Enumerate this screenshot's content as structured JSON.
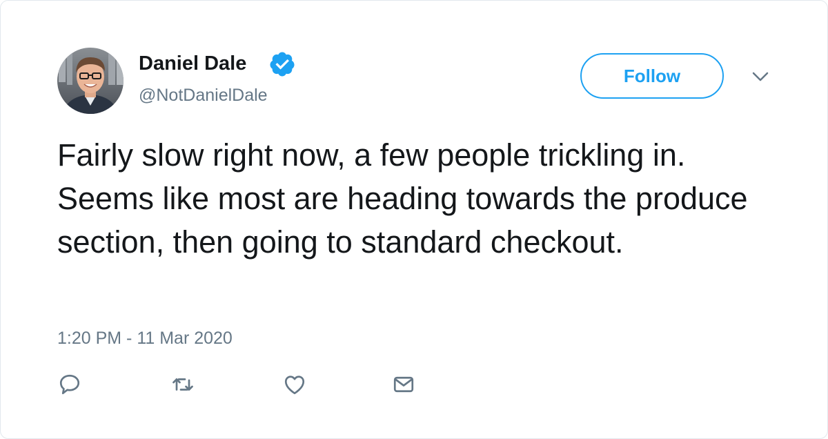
{
  "tweet": {
    "author": {
      "display_name": "Daniel Dale",
      "handle": "@NotDanielDale",
      "verified": true,
      "avatar_icon": "profile-photo"
    },
    "follow_label": "Follow",
    "menu_icon": "chevron-down-icon",
    "text": "Fairly slow right now, a few people trickling in. Seems like most are heading towards the produce section, then going to standard checkout.",
    "timestamp": "1:20 PM - 11 Mar 2020",
    "actions": [
      {
        "name": "reply",
        "icon": "reply-icon"
      },
      {
        "name": "retweet",
        "icon": "retweet-icon"
      },
      {
        "name": "like",
        "icon": "heart-icon"
      },
      {
        "name": "direct-message",
        "icon": "envelope-icon"
      }
    ]
  },
  "colors": {
    "accent": "#1da1f2",
    "text_primary": "#14171a",
    "text_secondary": "#657786",
    "icon_gray": "#657786",
    "border": "#e1e8ed"
  }
}
